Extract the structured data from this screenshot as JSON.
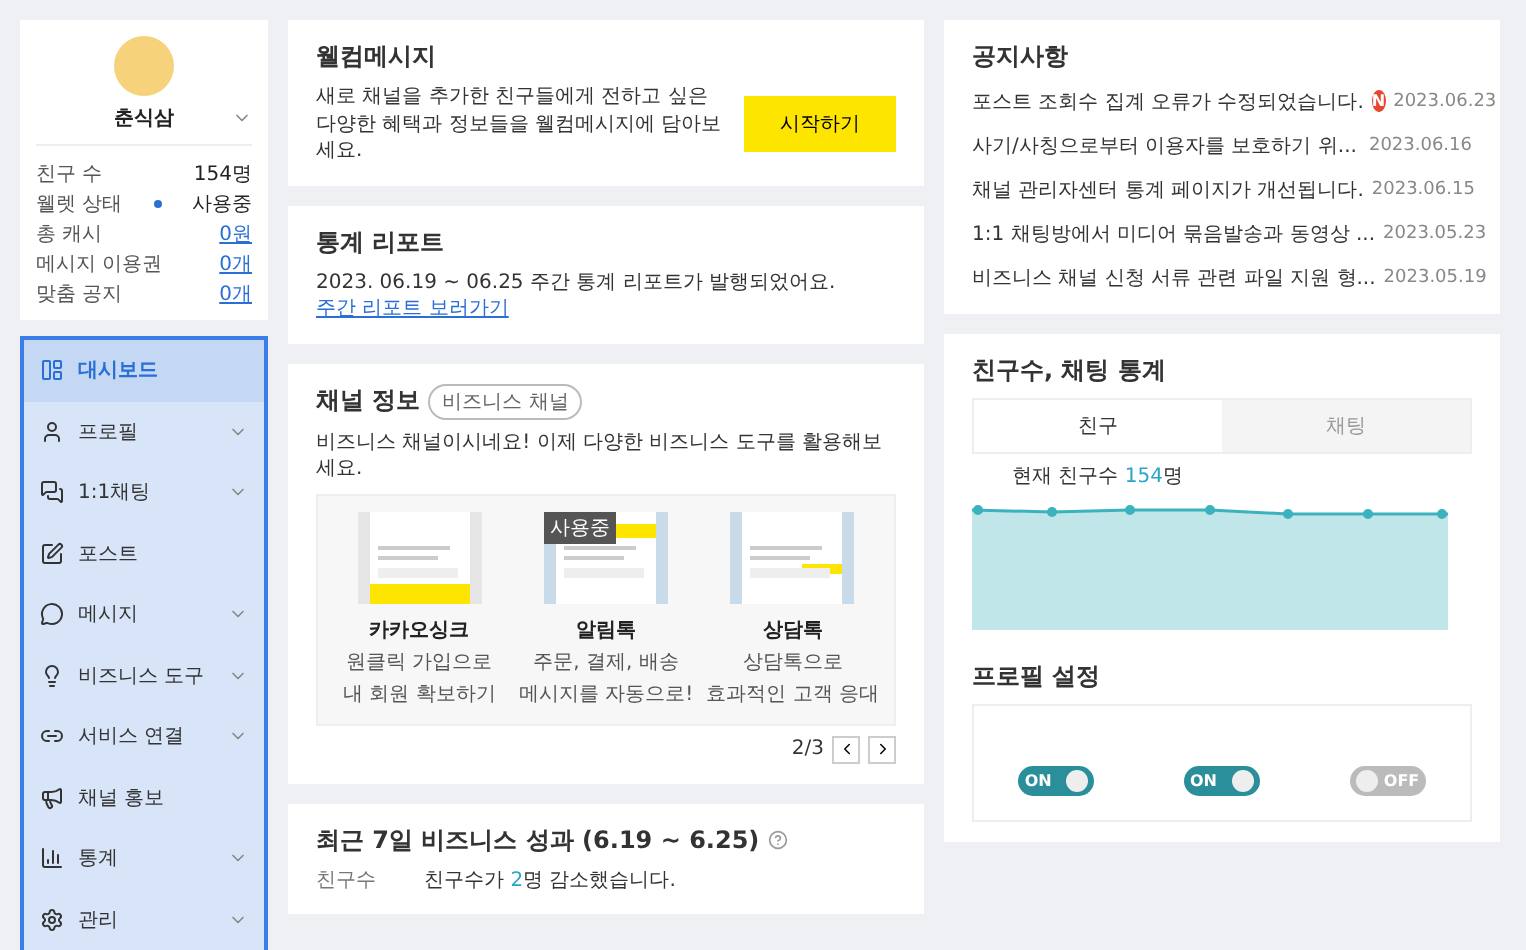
{
  "profile": {
    "name": "춘식삼",
    "stats": [
      {
        "label": "친구 수",
        "value": "154명",
        "kind": "text"
      },
      {
        "label": "웰렛 상태",
        "value": "사용중",
        "kind": "status"
      },
      {
        "label": "총 캐시",
        "value": "0원",
        "kind": "link"
      },
      {
        "label": "메시지 이용권",
        "value": "0개",
        "kind": "link"
      },
      {
        "label": "맞춤 공지",
        "value": "0개",
        "kind": "link"
      }
    ]
  },
  "nav": [
    {
      "label": "대시보드",
      "selected": true,
      "expandable": false
    },
    {
      "label": "프로필",
      "selected": false,
      "expandable": true
    },
    {
      "label": "1:1채팅",
      "selected": false,
      "expandable": true
    },
    {
      "label": "포스트",
      "selected": false,
      "expandable": false
    },
    {
      "label": "메시지",
      "selected": false,
      "expandable": true
    },
    {
      "label": "비즈니스 도구",
      "selected": false,
      "expandable": true
    },
    {
      "label": "서비스 연결",
      "selected": false,
      "expandable": true
    },
    {
      "label": "채널 홍보",
      "selected": false,
      "expandable": false
    },
    {
      "label": "통계",
      "selected": false,
      "expandable": true
    },
    {
      "label": "관리",
      "selected": false,
      "expandable": true
    }
  ],
  "welcome": {
    "title": "웰컴메시지",
    "text": "새로 채널을 추가한 친구들에게 전하고 싶은 다양한 혜택과 정보들을 웰컴메시지에 담아보세요.",
    "button": "시작하기"
  },
  "report": {
    "title": "통계 리포트",
    "text": "2023. 06.19 ~ 06.25 주간 통계 리포트가 발행되었어요.",
    "link": "주간 리포트 보러가기"
  },
  "channel": {
    "title": "채널 정보",
    "badge": "비즈니스 채널",
    "text": "비즈니스 채널이시네요! 이제 다양한 비즈니스 도구를 활용해보세요.",
    "page": "2/3",
    "features": [
      {
        "name": "카카오싱크",
        "lines": [
          "원클릭 가입으로",
          "내 회원 확보하기"
        ],
        "in_use": false
      },
      {
        "name": "알림톡",
        "lines": [
          "주문, 결제, 배송",
          "메시지를 자동으로!"
        ],
        "in_use": true,
        "badge": "사용중"
      },
      {
        "name": "상담톡",
        "lines": [
          "상담톡으로",
          "효과적인 고객 응대"
        ],
        "in_use": false
      }
    ]
  },
  "performance": {
    "title": "최근 7일 비즈니스 성과 (6.19 ~ 6.25)",
    "rows": [
      {
        "label": "친구수",
        "before": "친구수가 ",
        "highlight": "2",
        "after": "명 감소했습니다."
      }
    ]
  },
  "notices": {
    "title": "공지사항",
    "items": [
      {
        "title": "포스트 조회수 집계 오류가 수정되었습니다.",
        "new": true,
        "badge": "N",
        "date": "2023.06.23"
      },
      {
        "title": "사기/사칭으로부터 이용자를 보호하기 위...",
        "new": false,
        "date": "2023.06.16"
      },
      {
        "title": "채널 관리자센터 통계 페이지가 개선됩니다.",
        "new": false,
        "date": "2023.06.15"
      },
      {
        "title": "1:1 채팅방에서 미디어 묶음발송과 동영상 ...",
        "new": false,
        "date": "2023.05.23"
      },
      {
        "title": "비즈니스 채널 신청 서류 관련 파일 지원 형...",
        "new": false,
        "date": "2023.05.19"
      }
    ]
  },
  "stats": {
    "title": "친구수, 채팅 통계",
    "tabs": [
      {
        "label": "친구",
        "selected": true
      },
      {
        "label": "채팅",
        "selected": false
      }
    ],
    "summary_before": "현재 친구수 ",
    "summary_value": "154",
    "summary_after": "명"
  },
  "profile_settings": {
    "title": "프로필 설정",
    "toggles": [
      {
        "on": true,
        "text": "ON"
      },
      {
        "on": true,
        "text": "ON"
      },
      {
        "on": false,
        "text": "OFF"
      }
    ]
  }
}
